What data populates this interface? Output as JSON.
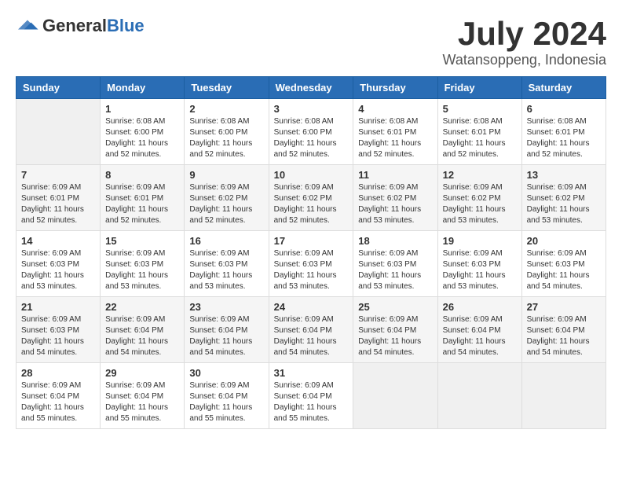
{
  "header": {
    "logo_general": "General",
    "logo_blue": "Blue",
    "month": "July 2024",
    "location": "Watansoppeng, Indonesia"
  },
  "weekdays": [
    "Sunday",
    "Monday",
    "Tuesday",
    "Wednesday",
    "Thursday",
    "Friday",
    "Saturday"
  ],
  "weeks": [
    [
      {
        "day": "",
        "info": ""
      },
      {
        "day": "1",
        "info": "Sunrise: 6:08 AM\nSunset: 6:00 PM\nDaylight: 11 hours\nand 52 minutes."
      },
      {
        "day": "2",
        "info": "Sunrise: 6:08 AM\nSunset: 6:00 PM\nDaylight: 11 hours\nand 52 minutes."
      },
      {
        "day": "3",
        "info": "Sunrise: 6:08 AM\nSunset: 6:00 PM\nDaylight: 11 hours\nand 52 minutes."
      },
      {
        "day": "4",
        "info": "Sunrise: 6:08 AM\nSunset: 6:01 PM\nDaylight: 11 hours\nand 52 minutes."
      },
      {
        "day": "5",
        "info": "Sunrise: 6:08 AM\nSunset: 6:01 PM\nDaylight: 11 hours\nand 52 minutes."
      },
      {
        "day": "6",
        "info": "Sunrise: 6:08 AM\nSunset: 6:01 PM\nDaylight: 11 hours\nand 52 minutes."
      }
    ],
    [
      {
        "day": "7",
        "info": "Sunrise: 6:09 AM\nSunset: 6:01 PM\nDaylight: 11 hours\nand 52 minutes."
      },
      {
        "day": "8",
        "info": "Sunrise: 6:09 AM\nSunset: 6:01 PM\nDaylight: 11 hours\nand 52 minutes."
      },
      {
        "day": "9",
        "info": "Sunrise: 6:09 AM\nSunset: 6:02 PM\nDaylight: 11 hours\nand 52 minutes."
      },
      {
        "day": "10",
        "info": "Sunrise: 6:09 AM\nSunset: 6:02 PM\nDaylight: 11 hours\nand 52 minutes."
      },
      {
        "day": "11",
        "info": "Sunrise: 6:09 AM\nSunset: 6:02 PM\nDaylight: 11 hours\nand 53 minutes."
      },
      {
        "day": "12",
        "info": "Sunrise: 6:09 AM\nSunset: 6:02 PM\nDaylight: 11 hours\nand 53 minutes."
      },
      {
        "day": "13",
        "info": "Sunrise: 6:09 AM\nSunset: 6:02 PM\nDaylight: 11 hours\nand 53 minutes."
      }
    ],
    [
      {
        "day": "14",
        "info": "Sunrise: 6:09 AM\nSunset: 6:03 PM\nDaylight: 11 hours\nand 53 minutes."
      },
      {
        "day": "15",
        "info": "Sunrise: 6:09 AM\nSunset: 6:03 PM\nDaylight: 11 hours\nand 53 minutes."
      },
      {
        "day": "16",
        "info": "Sunrise: 6:09 AM\nSunset: 6:03 PM\nDaylight: 11 hours\nand 53 minutes."
      },
      {
        "day": "17",
        "info": "Sunrise: 6:09 AM\nSunset: 6:03 PM\nDaylight: 11 hours\nand 53 minutes."
      },
      {
        "day": "18",
        "info": "Sunrise: 6:09 AM\nSunset: 6:03 PM\nDaylight: 11 hours\nand 53 minutes."
      },
      {
        "day": "19",
        "info": "Sunrise: 6:09 AM\nSunset: 6:03 PM\nDaylight: 11 hours\nand 53 minutes."
      },
      {
        "day": "20",
        "info": "Sunrise: 6:09 AM\nSunset: 6:03 PM\nDaylight: 11 hours\nand 54 minutes."
      }
    ],
    [
      {
        "day": "21",
        "info": "Sunrise: 6:09 AM\nSunset: 6:03 PM\nDaylight: 11 hours\nand 54 minutes."
      },
      {
        "day": "22",
        "info": "Sunrise: 6:09 AM\nSunset: 6:04 PM\nDaylight: 11 hours\nand 54 minutes."
      },
      {
        "day": "23",
        "info": "Sunrise: 6:09 AM\nSunset: 6:04 PM\nDaylight: 11 hours\nand 54 minutes."
      },
      {
        "day": "24",
        "info": "Sunrise: 6:09 AM\nSunset: 6:04 PM\nDaylight: 11 hours\nand 54 minutes."
      },
      {
        "day": "25",
        "info": "Sunrise: 6:09 AM\nSunset: 6:04 PM\nDaylight: 11 hours\nand 54 minutes."
      },
      {
        "day": "26",
        "info": "Sunrise: 6:09 AM\nSunset: 6:04 PM\nDaylight: 11 hours\nand 54 minutes."
      },
      {
        "day": "27",
        "info": "Sunrise: 6:09 AM\nSunset: 6:04 PM\nDaylight: 11 hours\nand 54 minutes."
      }
    ],
    [
      {
        "day": "28",
        "info": "Sunrise: 6:09 AM\nSunset: 6:04 PM\nDaylight: 11 hours\nand 55 minutes."
      },
      {
        "day": "29",
        "info": "Sunrise: 6:09 AM\nSunset: 6:04 PM\nDaylight: 11 hours\nand 55 minutes."
      },
      {
        "day": "30",
        "info": "Sunrise: 6:09 AM\nSunset: 6:04 PM\nDaylight: 11 hours\nand 55 minutes."
      },
      {
        "day": "31",
        "info": "Sunrise: 6:09 AM\nSunset: 6:04 PM\nDaylight: 11 hours\nand 55 minutes."
      },
      {
        "day": "",
        "info": ""
      },
      {
        "day": "",
        "info": ""
      },
      {
        "day": "",
        "info": ""
      }
    ]
  ]
}
